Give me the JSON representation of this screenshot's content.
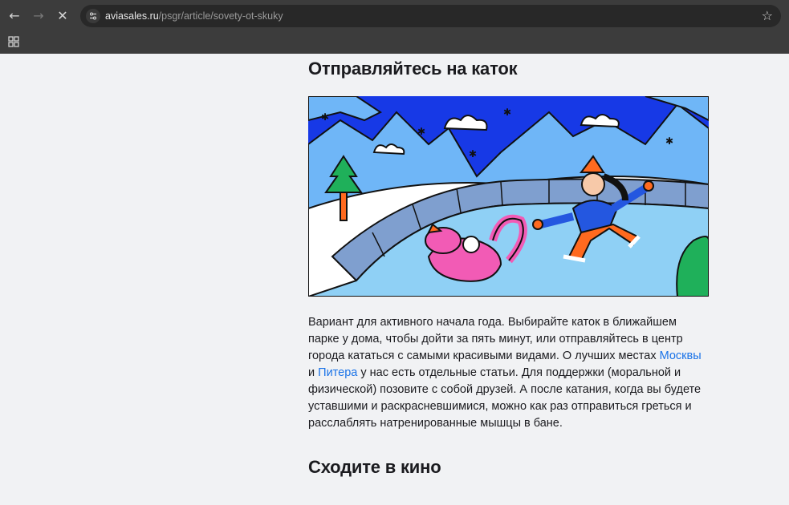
{
  "browser": {
    "url_host": "aviasales.ru",
    "url_path": "/psgr/article/sovety-ot-skuky"
  },
  "article": {
    "section1_title": "Отправляйтесь на каток",
    "paragraph": {
      "part1": "Вариант для активного начала года. Выбирайте каток в ближайшем парке у дома, чтобы дойти за пять минут, или отправляйтесь в центр города кататься с самыми красивыми видами. О лучших местах ",
      "link1": "Москвы",
      "part2": " и ",
      "link2": "Питера",
      "part3": " у нас есть отдельные статьи. Для поддержки (моральной и физической) позовите с собой друзей. А после катания, когда вы будете уставшими и раскрасневшимися, можно как раз отправиться греться и расслаблять натренированные мышцы в бане."
    },
    "section2_title": "Сходите в кино"
  },
  "colors": {
    "sky": "#1739e6",
    "mountains": "#6fb6f7",
    "ice": "#8fd0f5",
    "rink_wall": "#7f9fcf",
    "cat": "#f25bb5",
    "jacket": "#2457e0",
    "pants": "#ff6a1f",
    "tree": "#1fb05a",
    "link": "#1a73e8"
  }
}
